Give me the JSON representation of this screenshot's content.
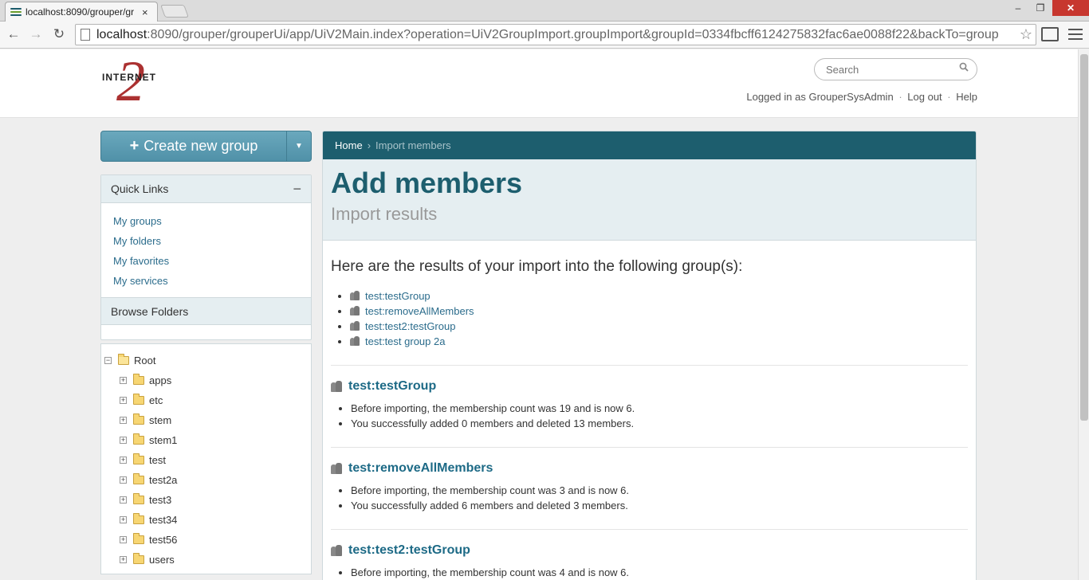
{
  "browser": {
    "tab_title": "localhost:8090/grouper/gr",
    "tab_close": "×",
    "url_host": "localhost",
    "url_rest": ":8090/grouper/grouperUi/app/UiV2Main.index?operation=UiV2GroupImport.groupImport&groupId=0334fbcff6124275832fac6ae0088f22&backTo=group",
    "minimize": "–",
    "maximize": "❐",
    "close": "✕",
    "back": "←",
    "forward": "→",
    "reload": "↻",
    "star": "☆"
  },
  "header": {
    "logo_text": "INTERNET",
    "logo_mark": "2",
    "search_placeholder": "Search",
    "logged_in": "Logged in as GrouperSysAdmin",
    "sep": "·",
    "logout": "Log out",
    "help": "Help"
  },
  "sidebar": {
    "create_label": "Create new group",
    "create_plus": "+",
    "create_caret": "▼",
    "quick_links_title": "Quick Links",
    "collapse": "−",
    "quick_links": [
      "My groups",
      "My folders",
      "My favorites",
      "My services"
    ],
    "browse_title": "Browse Folders",
    "root_label": "Root",
    "root_toggle": "−",
    "child_toggle": "+",
    "folders": [
      "apps",
      "etc",
      "stem",
      "stem1",
      "test",
      "test2a",
      "test3",
      "test34",
      "test56",
      "users"
    ]
  },
  "main": {
    "breadcrumb_home": "Home",
    "breadcrumb_chev": "›",
    "breadcrumb_current": "Import members",
    "title": "Add members",
    "subtitle": "Import results",
    "intro": "Here are the results of your import into the following group(s):",
    "groups": [
      "test:testGroup",
      "test:removeAllMembers",
      "test:test2:testGroup",
      "test:test group 2a"
    ],
    "results": [
      {
        "name": "test:testGroup",
        "lines": [
          "Before importing, the membership count was 19 and is now 6.",
          "You successfully added 0 members and deleted 13 members."
        ]
      },
      {
        "name": "test:removeAllMembers",
        "lines": [
          "Before importing, the membership count was 3 and is now 6.",
          "You successfully added 6 members and deleted 3 members."
        ]
      },
      {
        "name": "test:test2:testGroup",
        "lines": [
          "Before importing, the membership count was 4 and is now 6."
        ]
      }
    ]
  }
}
